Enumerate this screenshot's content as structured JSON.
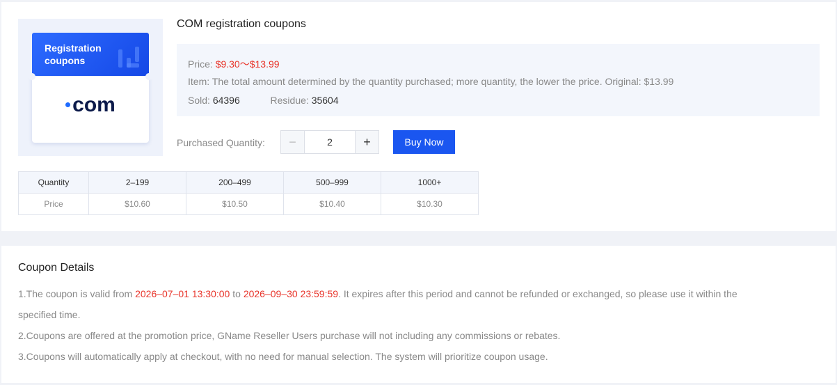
{
  "coupon_image": {
    "header_line1": "Registration",
    "header_line2": "coupons",
    "domain_text": "com",
    "accent": "#1a56f0"
  },
  "product": {
    "title": "COM registration coupons",
    "price_label": "Price:",
    "price_value": "$9.30～$13.99",
    "item_label": "Item:",
    "item_text": "The total amount determined by the quantity purchased; more quantity, the lower the price. Original: $13.99",
    "sold_label": "Sold:",
    "sold_value": "64396",
    "residue_label": "Residue:",
    "residue_value": "35604"
  },
  "purchase": {
    "quantity_label": "Purchased Quantity:",
    "minus": "−",
    "quantity_value": "2",
    "plus": "+",
    "buy_label": "Buy Now"
  },
  "price_table": {
    "header": [
      "Quantity",
      "2–199",
      "200–499",
      "500–999",
      "1000+"
    ],
    "row": [
      "Price",
      "$10.60",
      "$10.50",
      "$10.40",
      "$10.30"
    ]
  },
  "details": {
    "title": "Coupon Details",
    "line1_a": "1.The coupon is valid from ",
    "line1_start": "2026–07–01 13:30:00",
    "line1_b": " to ",
    "line1_end": "2026–09–30 23:59:59",
    "line1_c": ". It expires after this period and cannot be refunded or exchanged, so please use it within the",
    "line1_d": "specified time.",
    "line2": "2.Coupons are offered at the promotion price, GName Reseller Users purchase will not including any commissions or rebates.",
    "line3": "3.Coupons will automatically apply at checkout, with no need for manual selection. The system will prioritize coupon usage."
  },
  "colors": {
    "price_red": "#e8342a",
    "button_blue": "#1a56f0"
  }
}
